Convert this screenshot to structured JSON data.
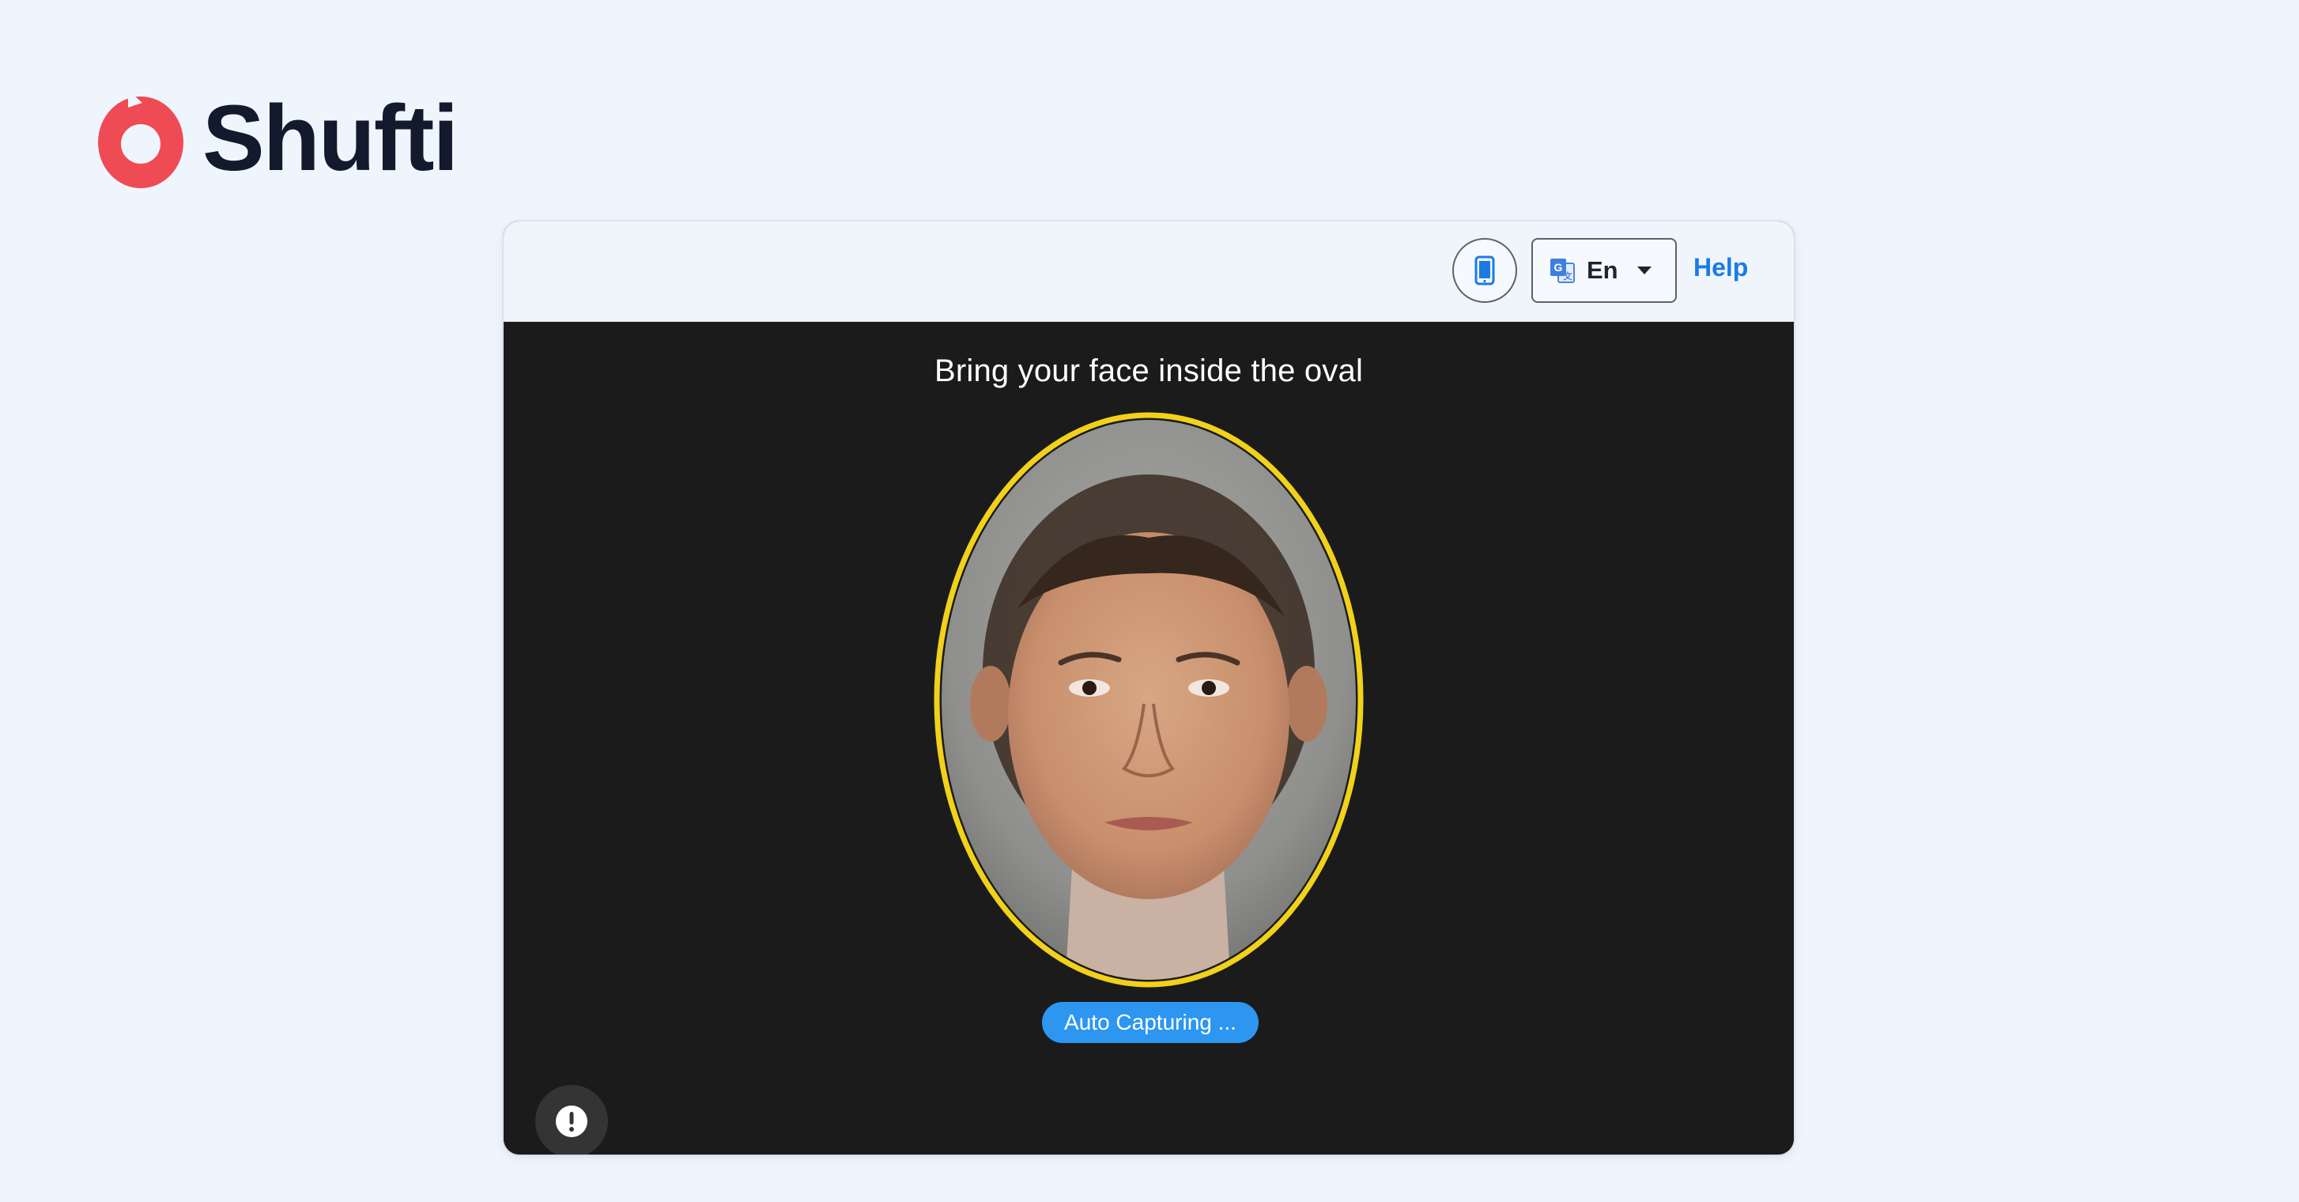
{
  "brand": {
    "name": "Shufti",
    "logo_color": "#ef4b55"
  },
  "header": {
    "device_icon": "smartphone-icon",
    "language": {
      "icon": "translate-icon",
      "value": "En"
    },
    "help_label": "Help"
  },
  "capture": {
    "instruction": "Bring your face inside the oval",
    "status": "Auto Capturing ...",
    "oval_color": "#f1d11a",
    "alert_icon": "exclamation-icon"
  },
  "colors": {
    "accent": "#1a7be6",
    "status_pill": "#2c96f0",
    "camera_background": "#1b1b1b",
    "page_background": "#eff5fd"
  }
}
